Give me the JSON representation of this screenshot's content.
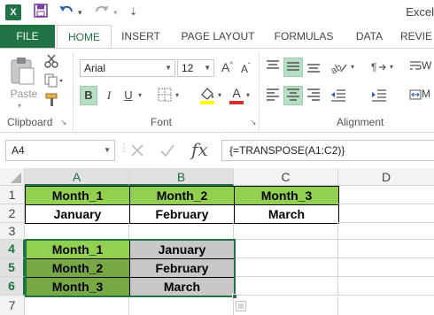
{
  "titlebar": {
    "app_icon": "X",
    "save_icon": "save-icon",
    "undo_icon": "undo-icon",
    "redo_icon": "redo-icon",
    "title": "Excel"
  },
  "tabs": {
    "file": "FILE",
    "home": "HOME",
    "insert": "INSERT",
    "page_layout": "PAGE LAYOUT",
    "formulas": "FORMULAS",
    "data": "DATA",
    "review": "REVIE"
  },
  "ribbon": {
    "clipboard": {
      "paste_label": "Paste",
      "group_label": "Clipboard"
    },
    "font": {
      "name": "Arial",
      "size": "12",
      "group_label": "Font",
      "grow_label": "A",
      "shrink_label": "A",
      "bold": "B",
      "italic": "I",
      "underline": "U",
      "font_color_label": "A",
      "font_color": "#d9302c",
      "fill_color": "#ffff00"
    },
    "alignment": {
      "group_label": "Alignment",
      "wrap_label": "W",
      "merge_label": "M"
    }
  },
  "formula_bar": {
    "name_box": "A4",
    "fx": "fx",
    "formula": "{=TRANSPOSE(A1:C2)}"
  },
  "sheet": {
    "columns": [
      "A",
      "B",
      "C",
      "D"
    ],
    "rows": [
      "1",
      "2",
      "3",
      "4",
      "5",
      "6",
      "7"
    ],
    "cells": {
      "A1": "Month_1",
      "B1": "Month_2",
      "C1": "Month_3",
      "A2": "January",
      "B2": "February",
      "C2": "March",
      "A4": "Month_1",
      "B4": "January",
      "A5": "Month_2",
      "B5": "February",
      "A6": "Month_3",
      "B6": "March"
    },
    "colors": {
      "header_green": "#92d050",
      "dark_green": "#76a843",
      "selection_gray": "#c8c8c8",
      "accent": "#217346"
    }
  }
}
